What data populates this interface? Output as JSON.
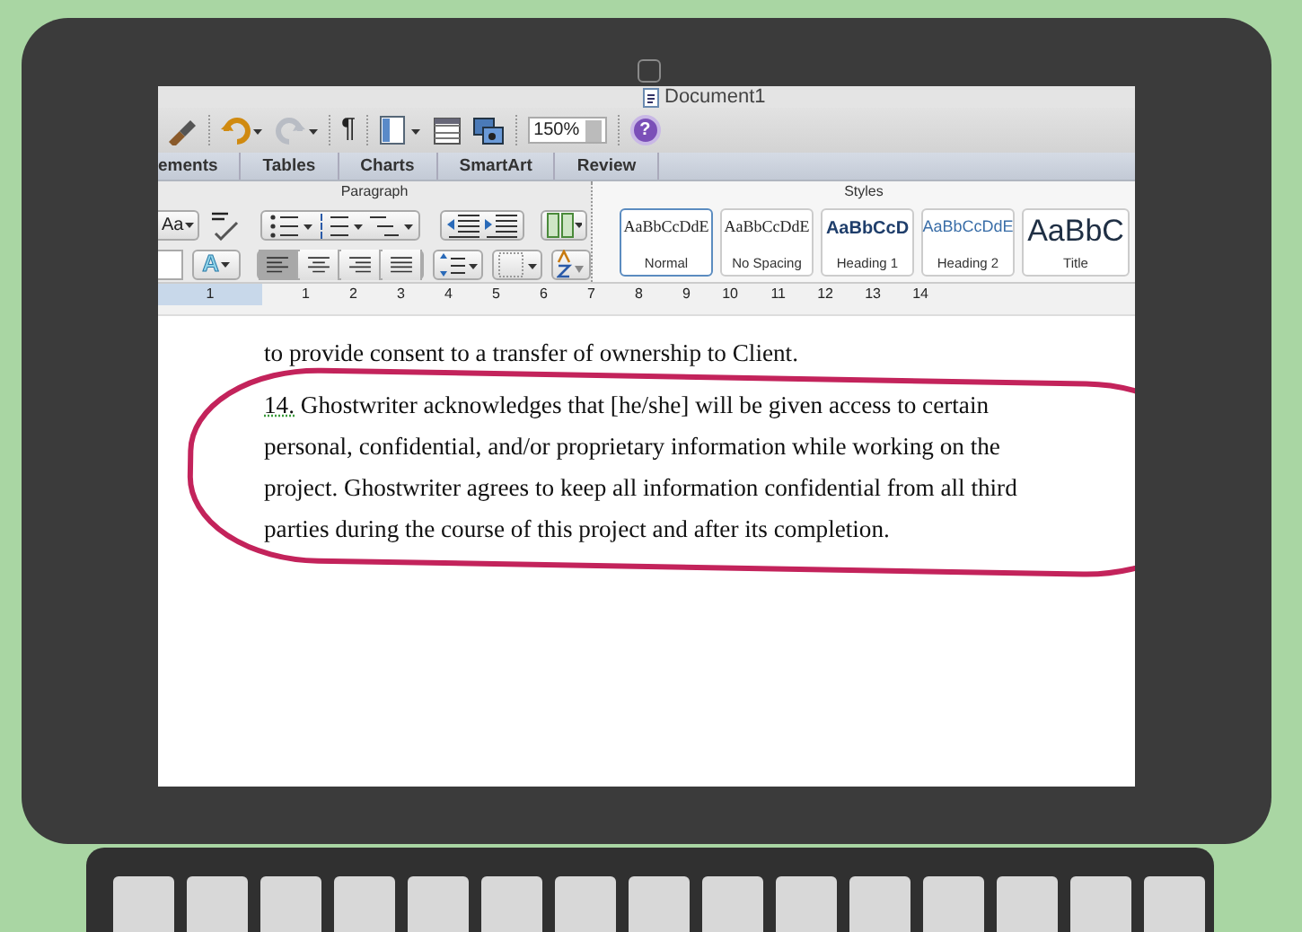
{
  "window": {
    "title": "Document1"
  },
  "toolbar": {
    "pilcrow": "¶",
    "zoom": "150%",
    "help": "?"
  },
  "tabs": [
    {
      "label": "ements"
    },
    {
      "label": "Tables"
    },
    {
      "label": "Charts"
    },
    {
      "label": "SmartArt"
    },
    {
      "label": "Review"
    }
  ],
  "ribbon": {
    "groups": [
      {
        "label": "Paragraph"
      },
      {
        "label": "Styles"
      }
    ],
    "font_button": "Aa",
    "text_effects": "A",
    "alignment": [
      {
        "selected": true
      },
      {
        "selected": false
      },
      {
        "selected": false
      },
      {
        "selected": false
      }
    ]
  },
  "styles": [
    {
      "kind": "body",
      "sample": "AaBbCcDdE",
      "label": "Normal",
      "selected": true
    },
    {
      "kind": "body",
      "sample": "AaBbCcDdE",
      "label": "No Spacing",
      "selected": false
    },
    {
      "kind": "heading1",
      "sample": "AaBbCcD",
      "label": "Heading 1",
      "selected": false
    },
    {
      "kind": "heading2",
      "sample": "AaBbCcDdE",
      "label": "Heading 2",
      "selected": false
    },
    {
      "kind": "title",
      "sample": "AaBbC",
      "label": "Title",
      "selected": false
    }
  ],
  "ruler": {
    "labels": [
      "1",
      "1",
      "2",
      "3",
      "4",
      "5",
      "6",
      "7",
      "8",
      "9",
      "10",
      "11",
      "12",
      "13",
      "14"
    ]
  },
  "document": {
    "paragraphs": [
      {
        "lines": [
          "to provide consent to a transfer of ownership to Client."
        ]
      },
      {
        "number": "14.",
        "grammar_flag": true,
        "lines": [
          "Ghostwriter acknowledges that [he/she] will be given access to certain",
          "personal, confidential, and/or proprietary information while working on the",
          "project. Ghostwriter agrees to keep all information confidential from all third",
          "parties during the course of this project and after its completion."
        ]
      }
    ]
  }
}
